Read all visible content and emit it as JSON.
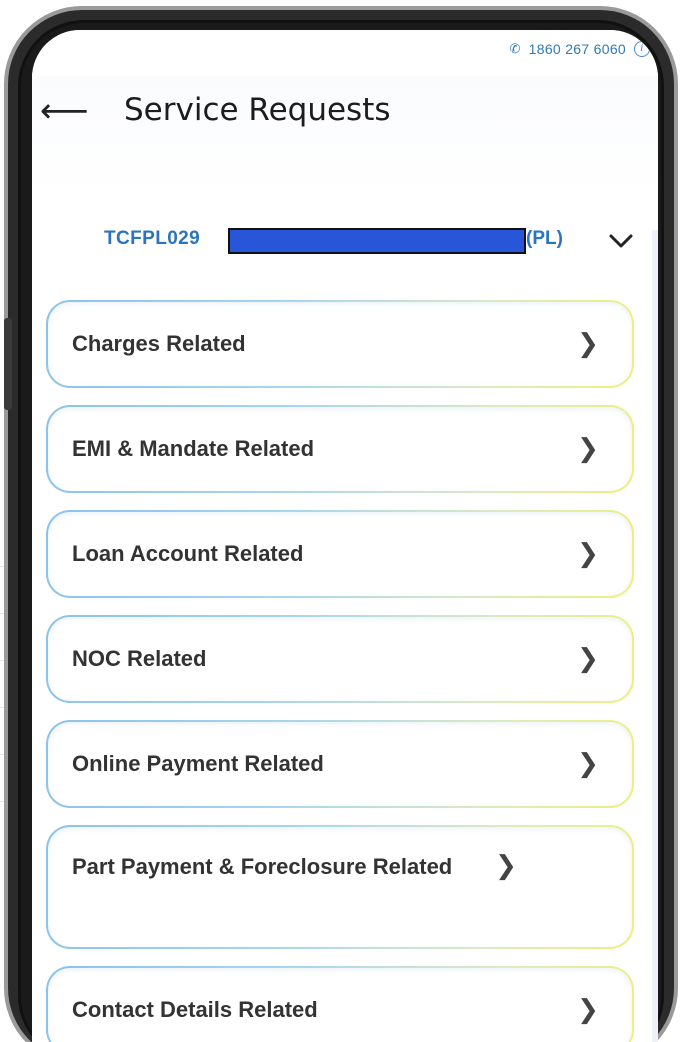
{
  "status_bar": {
    "phone_number": "1860 267 6060",
    "phone_icon": "phone-icon",
    "info_icon": "info-icon"
  },
  "header": {
    "title": "Service Requests",
    "back_icon": "back-arrow-icon"
  },
  "loan_selector": {
    "loan_id_prefix": "TCFPL029",
    "loan_id_suffix": "(PL)",
    "dropdown_icon": "chevron-down-icon"
  },
  "menu": {
    "items": [
      {
        "label": "Charges Related"
      },
      {
        "label": "EMI & Mandate Related"
      },
      {
        "label": "Loan Account Related"
      },
      {
        "label": "NOC Related"
      },
      {
        "label": "Online Payment Related"
      },
      {
        "label": "Part Payment & Foreclosure Related"
      },
      {
        "label": "Contact Details Related"
      }
    ],
    "item_icon": "chevron-right-icon"
  },
  "colors": {
    "accent_blue": "#2c73c0",
    "redaction": "#2856d9",
    "card_gradient_start": "#8cc2ea",
    "card_gradient_end": "#eef07a"
  }
}
